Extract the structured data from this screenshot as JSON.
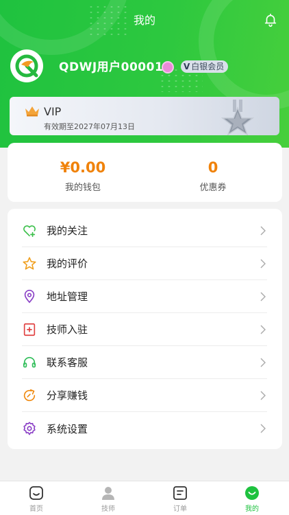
{
  "header": {
    "title": "我的"
  },
  "user": {
    "name": "QDWJ用户00001",
    "badge_letter": "V",
    "member_level": "白银会员"
  },
  "vip": {
    "title": "VIP",
    "expire_text": "有效期至2027年07月13日"
  },
  "stats": [
    {
      "value": "¥0.00",
      "label": "我的钱包"
    },
    {
      "value": "0",
      "label": "优惠券"
    }
  ],
  "menu": [
    {
      "label": "我的关注",
      "icon": "heart-plus-icon",
      "color": "#3bbf4a"
    },
    {
      "label": "我的评价",
      "icon": "star-icon",
      "color": "#f0a020"
    },
    {
      "label": "地址管理",
      "icon": "location-pin-icon",
      "color": "#8a3fc6"
    },
    {
      "label": "技师入驻",
      "icon": "plus-square-icon",
      "color": "#e04040"
    },
    {
      "label": "联系客服",
      "icon": "headset-icon",
      "color": "#2ebd58"
    },
    {
      "label": "分享赚钱",
      "icon": "share-refresh-icon",
      "color": "#f08a10"
    },
    {
      "label": "系统设置",
      "icon": "settings-icon",
      "color": "#8a3fc6"
    }
  ],
  "tabs": [
    {
      "label": "首页",
      "icon": "home-icon",
      "active": false
    },
    {
      "label": "技师",
      "icon": "technician-icon",
      "active": false
    },
    {
      "label": "订单",
      "icon": "order-icon",
      "active": false
    },
    {
      "label": "我的",
      "icon": "profile-smile-icon",
      "active": true
    }
  ],
  "colors": {
    "brand_green": "#1fc23f",
    "wallet_orange": "#f0820a",
    "tab_active": "#1ec23f",
    "tab_inactive": "#999999"
  }
}
